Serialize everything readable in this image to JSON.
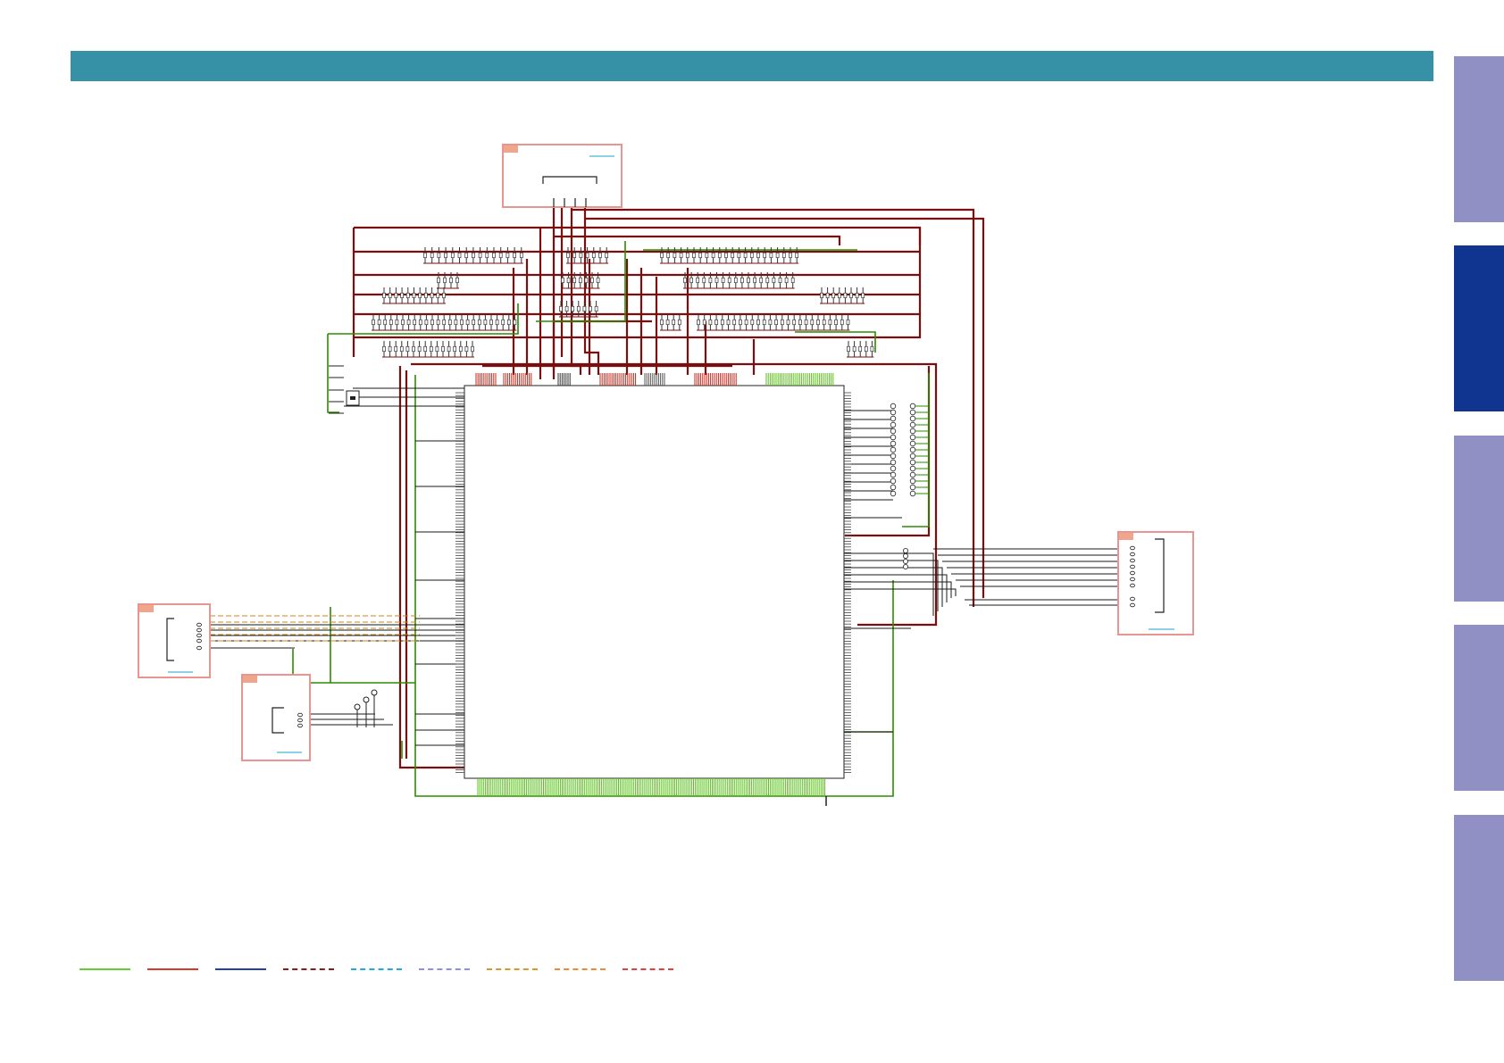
{
  "header": {
    "color": "#3691a6"
  },
  "side_tabs": [
    {
      "state": "inactive",
      "color": "#9090c4"
    },
    {
      "state": "active",
      "color": "#0f3591"
    },
    {
      "state": "inactive",
      "color": "#9090c4"
    },
    {
      "state": "inactive",
      "color": "#9090c4"
    },
    {
      "state": "inactive",
      "color": "#9090c4"
    }
  ],
  "colors": {
    "wire_dark_red": "#7a0f0f",
    "wire_green": "#2e8b00",
    "wire_black": "#1a1a1a",
    "pin_green": "#59c21a",
    "pin_red": "#c0281c",
    "connector_box": "#e8958f",
    "connector_tag": "#f0a58d",
    "link_cyan": "#1aa6c8"
  },
  "legend": [
    {
      "style": "solid",
      "color": "#66cc33"
    },
    {
      "style": "solid",
      "color": "#d83a2a"
    },
    {
      "style": "solid",
      "color": "#2440a8"
    },
    {
      "style": "dashed",
      "color": "#8b1a1a"
    },
    {
      "style": "dashed",
      "color": "#22aadd"
    },
    {
      "style": "dashed",
      "color": "#8e8ee6"
    },
    {
      "style": "dashed",
      "color": "#d49a2a"
    },
    {
      "style": "dashed",
      "color": "#ee8833"
    },
    {
      "style": "dashed",
      "color": "#e04040"
    }
  ]
}
